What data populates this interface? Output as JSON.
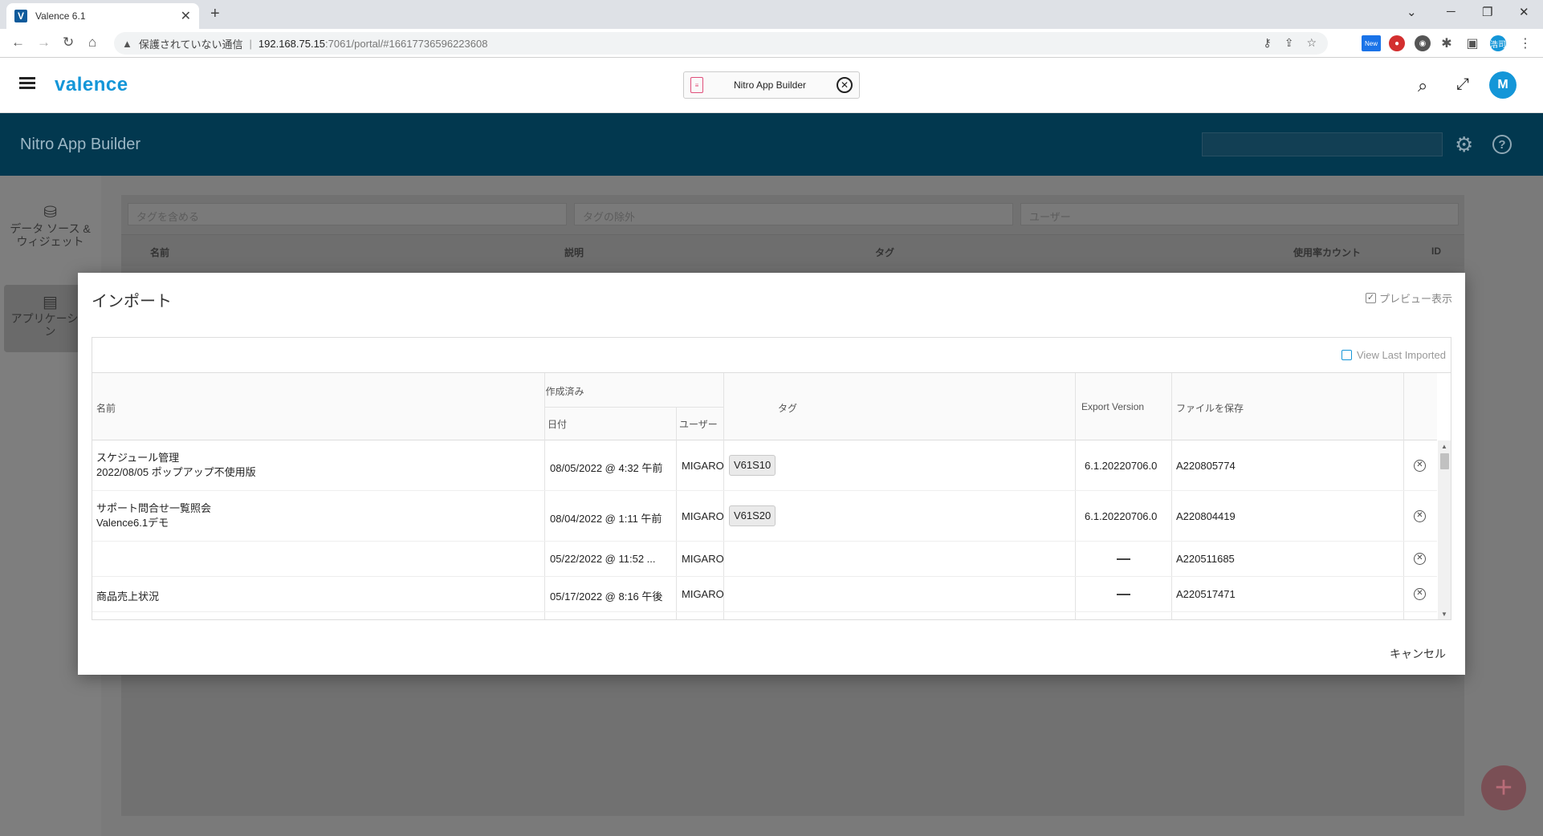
{
  "browser": {
    "tab_title": "Valence 6.1",
    "favicon_letter": "V",
    "insecure_label": "保護されていない通信",
    "url_host": "192.168.75.15",
    "url_rest": ":7061/portal/#16617736596223608",
    "ext_new_label": "New",
    "profile_label": "浩司"
  },
  "header": {
    "logo": "valence",
    "open_app": "Nitro App Builder",
    "avatar_initial": "M"
  },
  "appbar": {
    "title": "Nitro App Builder"
  },
  "sidebar": {
    "items": [
      {
        "label": "データ ソース & ウィジェット"
      },
      {
        "label": "アプリケーション"
      }
    ]
  },
  "background_list": {
    "filters": [
      "タグを含める",
      "タグの除外",
      "ユーザー"
    ],
    "columns": [
      "名前",
      "説明",
      "タグ",
      "使用率カウント",
      "ID"
    ]
  },
  "modal": {
    "title": "インポート",
    "preview_label": "プレビュー表示",
    "view_last_imported": "View Last Imported",
    "columns": {
      "name": "名前",
      "created": "作成済み",
      "date": "日付",
      "user": "ユーザー",
      "tags": "タグ",
      "export_version": "Export Version",
      "save_file": "ファイルを保存"
    },
    "rows": [
      {
        "name1": "スケジュール管理",
        "name2": "2022/08/05 ポップアップ不使用版",
        "date": "08/05/2022 @ 4:32 午前",
        "user": "MIGARO",
        "tag": "V61S10",
        "version": "6.1.20220706.0",
        "file": "A220805774"
      },
      {
        "name1": "サポート問合せ一覧照会",
        "name2": "Valence6.1デモ",
        "date": "08/04/2022 @ 1:11 午前",
        "user": "MIGARO",
        "tag": "V61S20",
        "version": "6.1.20220706.0",
        "file": "A220804419"
      },
      {
        "name1": "",
        "name2": "",
        "date": "05/22/2022 @ 11:52 ...",
        "user": "MIGARO",
        "tag": "",
        "version": "",
        "file": "A220511685"
      },
      {
        "name1": "商品売上状況",
        "name2": "",
        "date": "05/17/2022 @ 8:16 午後",
        "user": "MIGARO",
        "tag": "",
        "version": "",
        "file": "A220517471"
      }
    ],
    "cancel_label": "キャンセル"
  }
}
